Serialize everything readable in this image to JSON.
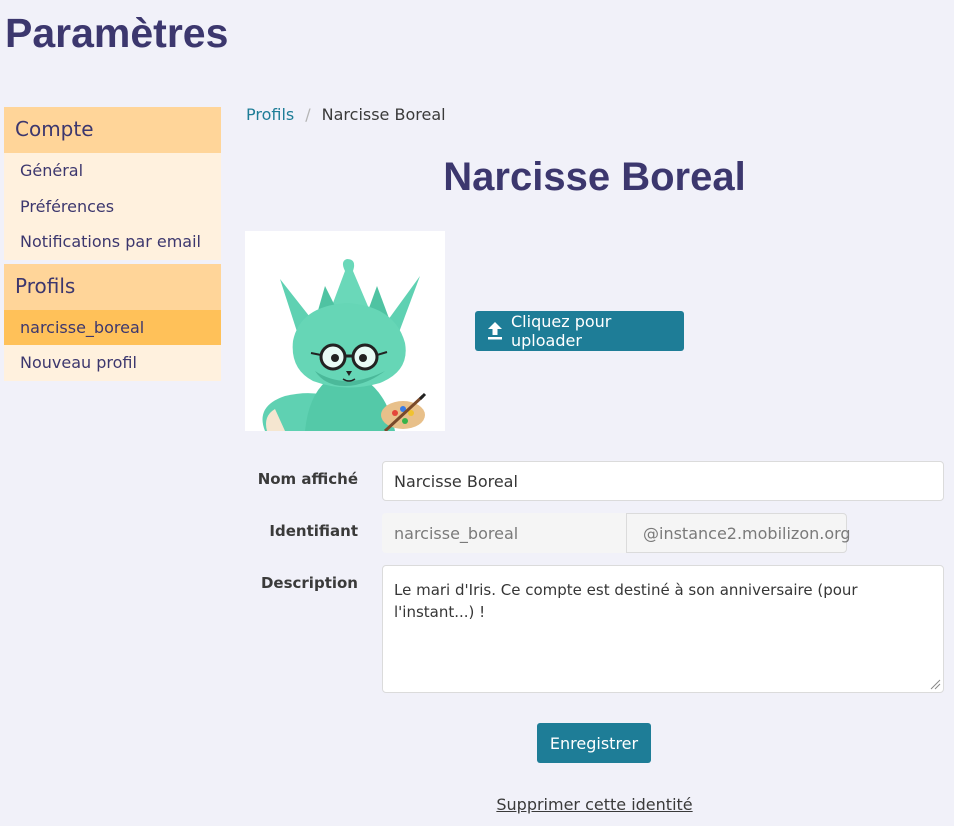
{
  "page": {
    "title": "Paramètres"
  },
  "sidebar": {
    "groups": [
      {
        "heading": "Compte",
        "items": [
          {
            "label": "Général"
          },
          {
            "label": "Préférences"
          },
          {
            "label": "Notifications par email"
          }
        ]
      },
      {
        "heading": "Profils",
        "items": [
          {
            "label": "narcisse_boreal",
            "active": true
          },
          {
            "label": "Nouveau profil"
          }
        ]
      }
    ]
  },
  "breadcrumb": {
    "parent": "Profils",
    "separator": "/",
    "current": "Narcisse Boreal"
  },
  "profile": {
    "title": "Narcisse Boreal",
    "upload_label": "Cliquez pour uploader",
    "upload_icon": "upload-icon"
  },
  "form": {
    "display_name": {
      "label": "Nom affiché",
      "value": "Narcisse Boreal"
    },
    "identifier": {
      "label": "Identifiant",
      "value": "narcisse_boreal",
      "domain": "@instance2.mobilizon.org"
    },
    "description": {
      "label": "Description",
      "value": "Le mari d'Iris. Ce compte est destiné à son anniversaire (pour l'instant...) !"
    },
    "save_label": "Enregistrer",
    "delete_label": "Supprimer cette identité"
  },
  "colors": {
    "background": "#f1f1f9",
    "primary": "#1e7d97",
    "title": "#3c376e",
    "sidebar_heading": "#ffd599",
    "sidebar_active": "#ffc159",
    "sidebar_bg": "#fff1de"
  }
}
